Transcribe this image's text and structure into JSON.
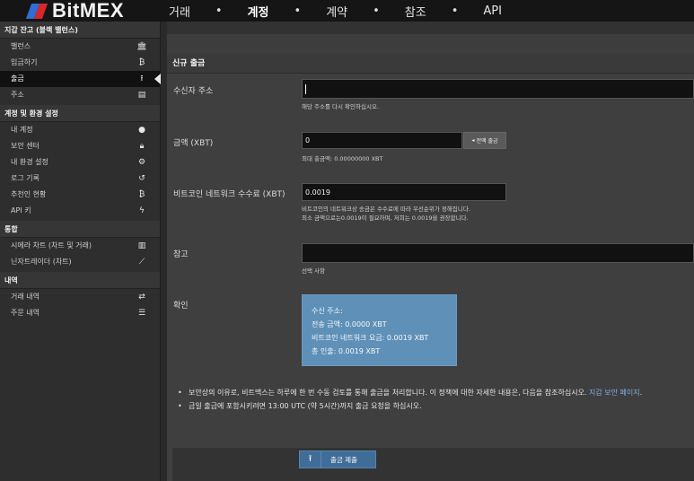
{
  "brand": {
    "name": "BitMEX"
  },
  "nav": {
    "items": [
      "거래",
      "계정",
      "계약",
      "참조",
      "API"
    ],
    "separator": "•",
    "active": "계정"
  },
  "sidebar": {
    "wallet_header": "지갑 잔고 (블랙 밸런스)",
    "wallet_items": [
      {
        "label": "밸런스",
        "icon": "bank-icon"
      },
      {
        "label": "입금하기",
        "icon": "bitcoin-icon"
      },
      {
        "label": "출금",
        "icon": "upload-icon"
      },
      {
        "label": "주소",
        "icon": "address-book-icon"
      }
    ],
    "account_header": "계정 및 환경 설정",
    "account_items": [
      {
        "label": "내 계정",
        "icon": "user-icon"
      },
      {
        "label": "보안 센터",
        "icon": "lock-icon"
      },
      {
        "label": "내 환경 설정",
        "icon": "gear-icon"
      },
      {
        "label": "로그 기록",
        "icon": "history-icon"
      },
      {
        "label": "추천인 현황",
        "icon": "bitcoin-icon"
      },
      {
        "label": "API 키",
        "icon": "bolt-icon"
      }
    ],
    "integration_header": "통합",
    "integration_items": [
      {
        "label": "시에라 차트 (차트 및 거래)",
        "icon": "bar-chart-icon"
      },
      {
        "label": "닌자트레이더 (차트)",
        "icon": "line-chart-icon"
      }
    ],
    "history_header": "내역",
    "history_items": [
      {
        "label": "거래 내역",
        "icon": "exchange-icon"
      },
      {
        "label": "주문 내역",
        "icon": "list-icon"
      }
    ]
  },
  "form": {
    "title": "신규 출금",
    "address_label": "수신자 주소",
    "address_value": "",
    "address_help": "해당 주소를 다시 확인하십시오.",
    "amount_label": "금액 (XBT)",
    "amount_value": "0",
    "max_button": "전액 출금",
    "amount_help": "최대 출금액: 0.00000000 XBT",
    "fee_label": "비트코인 네트워크 수수료 (XBT)",
    "fee_value": "0.0019",
    "fee_help_1": "비트코인의 네트워크상 송금은 수수료에 따라 우선순위가 정해집니다.",
    "fee_help_2": "최소 금액으로는0.0019이 필요하며, 저희는 0.0019을 권장합니다.",
    "memo_label": "참고",
    "memo_value": "",
    "memo_help": "선택 사항",
    "confirm_label": "확인",
    "confirm_lines": [
      "수신 주소:",
      "전송 금액: 0.0000 XBT",
      "비트코인 네트워크 요금: 0.0019 XBT",
      "총 인출: 0.0019 XBT"
    ]
  },
  "notes": {
    "note1_text": "보안상의 이유로, 비트맥스는 하루에 한 번 수동 검토를 통해 출금을 처리합니다. 이 정책에 대한 자세한 내용은, 다음을 참조하십시오.",
    "note1_link": "지갑 보안 페이지",
    "note1_end": ".",
    "note2_text": "금일 출금에 포함시키려면 13:00 UTC (약 5시간)까지 출금 요청을 하십시오."
  },
  "submit": {
    "label": "출금 제출"
  }
}
